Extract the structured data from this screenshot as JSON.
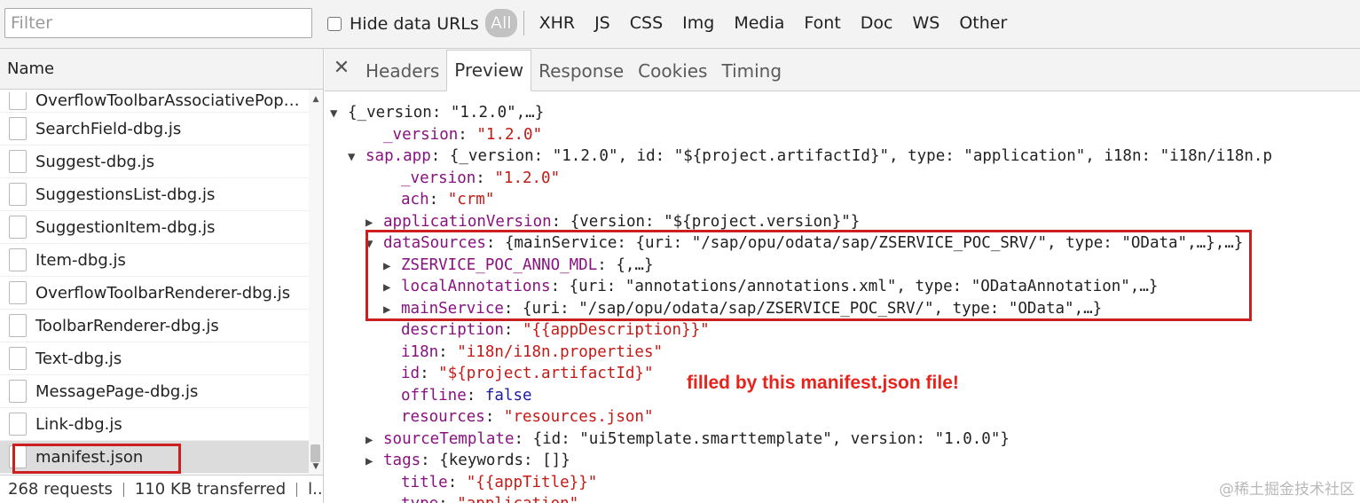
{
  "toolbar": {
    "filter_placeholder": "Filter",
    "hide_data_urls_label": "Hide data URLs",
    "type_filters": [
      "All",
      "XHR",
      "JS",
      "CSS",
      "Img",
      "Media",
      "Font",
      "Doc",
      "WS",
      "Other"
    ]
  },
  "request_list": {
    "header": "Name",
    "items": [
      "OverflowToolbarAssociativePop…",
      "SearchField-dbg.js",
      "Suggest-dbg.js",
      "SuggestionsList-dbg.js",
      "SuggestionItem-dbg.js",
      "Item-dbg.js",
      "OverflowToolbarRenderer-dbg.js",
      "ToolbarRenderer-dbg.js",
      "Text-dbg.js",
      "MessagePage-dbg.js",
      "Link-dbg.js",
      "manifest.json"
    ],
    "selected_item": "manifest.json",
    "status": {
      "requests": "268 requests",
      "transferred": "110 KB transferred",
      "more": "l..."
    }
  },
  "detail_tabs": [
    "Headers",
    "Preview",
    "Response",
    "Cookies",
    "Timing"
  ],
  "active_tab": "Preview",
  "json_preview": {
    "lines": [
      {
        "arrow": "▼",
        "parts": [
          {
            "t": "p",
            "v": "{_version: \"1.2.0\",…}"
          }
        ]
      },
      {
        "arrow": "",
        "parts": [
          {
            "t": "k",
            "v": "_version"
          },
          {
            "t": "p",
            "v": ": "
          },
          {
            "t": "s",
            "v": "\"1.2.0\""
          }
        ]
      },
      {
        "arrow": "▼",
        "parts": [
          {
            "t": "k",
            "v": "sap.app"
          },
          {
            "t": "p",
            "v": ": {_version: \"1.2.0\", id: \"${project.artifactId}\", type: \"application\", i18n: \"i18n/i18n.p"
          }
        ]
      },
      {
        "arrow": "",
        "parts": [
          {
            "t": "k",
            "v": "_version"
          },
          {
            "t": "p",
            "v": ": "
          },
          {
            "t": "s",
            "v": "\"1.2.0\""
          }
        ]
      },
      {
        "arrow": "",
        "parts": [
          {
            "t": "k",
            "v": "ach"
          },
          {
            "t": "p",
            "v": ": "
          },
          {
            "t": "s",
            "v": "\"crm\""
          }
        ]
      },
      {
        "arrow": "▶",
        "parts": [
          {
            "t": "k",
            "v": "applicationVersion"
          },
          {
            "t": "p",
            "v": ": {version: \"${project.version}\"}"
          }
        ]
      },
      {
        "arrow": "▼",
        "parts": [
          {
            "t": "k",
            "v": "dataSources"
          },
          {
            "t": "p",
            "v": ": {mainService: {uri: \"/sap/opu/odata/sap/ZSERVICE_POC_SRV/\", type: \"OData\",…},…}"
          }
        ]
      },
      {
        "arrow": "▶",
        "parts": [
          {
            "t": "k",
            "v": "ZSERVICE_POC_ANNO_MDL"
          },
          {
            "t": "p",
            "v": ": {,…}"
          }
        ]
      },
      {
        "arrow": "▶",
        "parts": [
          {
            "t": "k",
            "v": "localAnnotations"
          },
          {
            "t": "p",
            "v": ": {uri: \"annotations/annotations.xml\", type: \"ODataAnnotation\",…}"
          }
        ]
      },
      {
        "arrow": "▶",
        "parts": [
          {
            "t": "k",
            "v": "mainService"
          },
          {
            "t": "p",
            "v": ": {uri: \"/sap/opu/odata/sap/ZSERVICE_POC_SRV/\", type: \"OData\",…}"
          }
        ]
      },
      {
        "arrow": "",
        "parts": [
          {
            "t": "k",
            "v": "description"
          },
          {
            "t": "p",
            "v": ": "
          },
          {
            "t": "s",
            "v": "\"{{appDescription}}\""
          }
        ]
      },
      {
        "arrow": "",
        "parts": [
          {
            "t": "k",
            "v": "i18n"
          },
          {
            "t": "p",
            "v": ": "
          },
          {
            "t": "s",
            "v": "\"i18n/i18n.properties\""
          }
        ]
      },
      {
        "arrow": "",
        "parts": [
          {
            "t": "k",
            "v": "id"
          },
          {
            "t": "p",
            "v": ": "
          },
          {
            "t": "s",
            "v": "\"${project.artifactId}\""
          }
        ]
      },
      {
        "arrow": "",
        "parts": [
          {
            "t": "k",
            "v": "offline"
          },
          {
            "t": "p",
            "v": ": "
          },
          {
            "t": "b",
            "v": "false"
          }
        ]
      },
      {
        "arrow": "",
        "parts": [
          {
            "t": "k",
            "v": "resources"
          },
          {
            "t": "p",
            "v": ": "
          },
          {
            "t": "s",
            "v": "\"resources.json\""
          }
        ]
      },
      {
        "arrow": "▶",
        "parts": [
          {
            "t": "k",
            "v": "sourceTemplate"
          },
          {
            "t": "p",
            "v": ": {id: \"ui5template.smarttemplate\", version: \"1.0.0\"}"
          }
        ]
      },
      {
        "arrow": "▶",
        "parts": [
          {
            "t": "k",
            "v": "tags"
          },
          {
            "t": "p",
            "v": ": {keywords: []}"
          }
        ]
      },
      {
        "arrow": "",
        "parts": [
          {
            "t": "k",
            "v": "title"
          },
          {
            "t": "p",
            "v": ": "
          },
          {
            "t": "s",
            "v": "\"{{appTitle}}\""
          }
        ]
      },
      {
        "arrow": "",
        "parts": [
          {
            "t": "k",
            "v": "type"
          },
          {
            "t": "p",
            "v": ": "
          },
          {
            "t": "s",
            "v": "\"application\""
          }
        ]
      }
    ]
  },
  "annotation_text": "filled by this manifest.json file!",
  "watermark": "@稀土掘金技术社区",
  "colors": {
    "highlight_box": "#cc1f1f",
    "annotation": "#e8231c",
    "json_key": "#881280",
    "json_string": "#c41a16",
    "json_bool": "#1a1aa6"
  }
}
